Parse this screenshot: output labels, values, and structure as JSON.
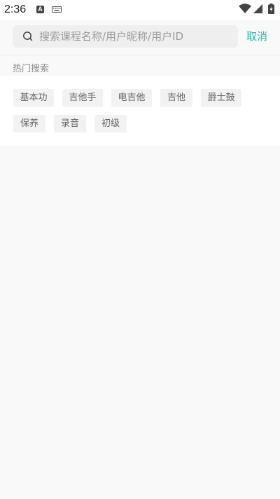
{
  "status_bar": {
    "time": "2:36",
    "icons": [
      "a-notification-icon",
      "keyboard-icon",
      "wifi-icon",
      "signal-icon",
      "battery-icon"
    ],
    "a_label": "A"
  },
  "search": {
    "placeholder": "搜索课程名称/用户昵称/用户ID",
    "value": "",
    "cancel_label": "取消"
  },
  "hot_search": {
    "title": "热门搜索",
    "tags": [
      "基本功",
      "吉他手",
      "电吉他",
      "吉他",
      "爵士鼓",
      "保养",
      "录音",
      "初级"
    ]
  },
  "colors": {
    "accent": "#1fb8a1",
    "tag_bg": "#f2f2f2",
    "page_bg": "#f9f9f9"
  }
}
